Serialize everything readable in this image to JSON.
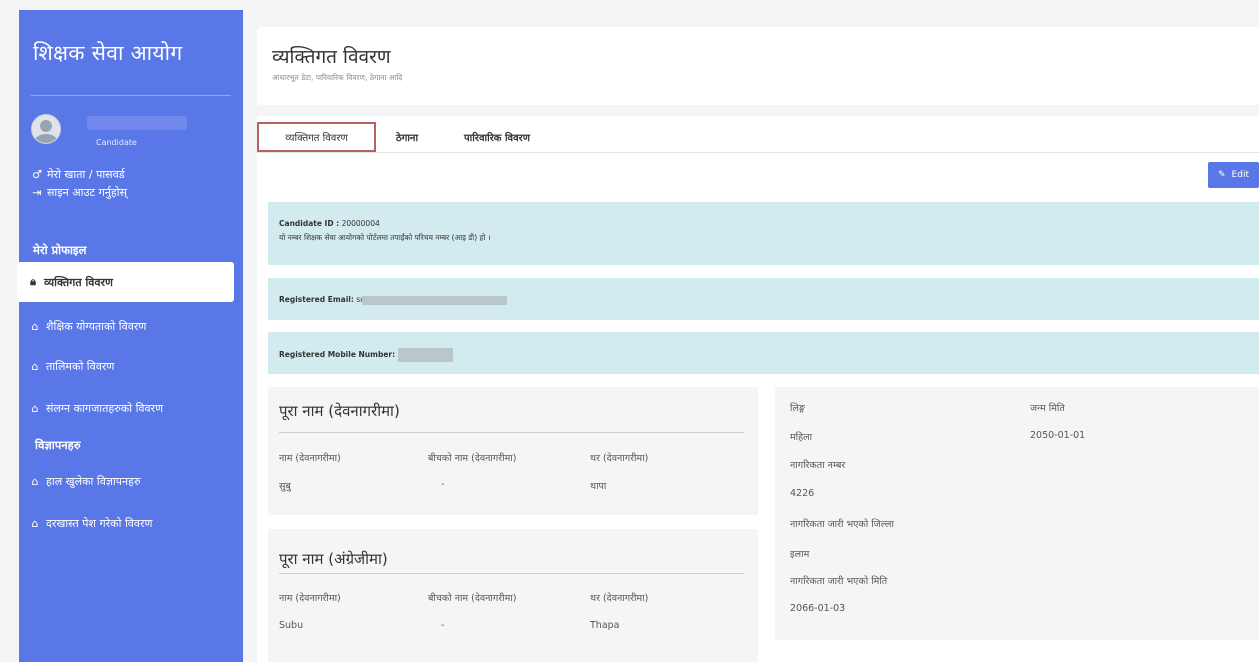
{
  "sidebar": {
    "brand": "शिक्षक सेवा आयोग",
    "user_role": "Candidate",
    "account_link": "मेरो खाता / पासवर्ड",
    "signout_link": "साइन आउट गर्नुहोस्",
    "profile_section": "मेरो प्रोफाइल",
    "items": [
      {
        "label": "व्यक्तिगत विवरण"
      },
      {
        "label": "शैक्षिक योग्यताको विवरण"
      },
      {
        "label": "तालिमको विवरण"
      },
      {
        "label": "संलग्न कागजातहरुको विवरण"
      }
    ],
    "ads_section": "विज्ञापनहरु",
    "ad_items": [
      {
        "label": "हाल खुलेका विज्ञापनहरु"
      },
      {
        "label": "दरखास्त पेश गरेको विवरण"
      }
    ]
  },
  "header": {
    "title": "व्यक्तिगत विवरण",
    "subtitle": "आधारभूत डेटा, पारिवारिक विवरण, ठेगाना आदि"
  },
  "tabs": [
    {
      "label": "व्यक्तिगत विवरण"
    },
    {
      "label": "ठेगाना"
    },
    {
      "label": "पारिवारिक विवरण"
    }
  ],
  "edit_label": "Edit",
  "candidate": {
    "id_label": "Candidate ID :",
    "id_value": "20000004",
    "id_note": "यो नम्बर शिक्षक सेवा आयोगको पोर्टलमा तपाईंको परिचय नम्बर (आइ डी) हो ।",
    "email_label": "Registered Email:",
    "email_visible": "sı",
    "mobile_label": "Registered Mobile Number:"
  },
  "name_np": {
    "title": "पूरा नाम (देवनागरीमा)",
    "labels": [
      "नाम (देवनागरीमा)",
      "बीचको नाम (देवनागरीमा)",
      "थर (देवनागरीमा)"
    ],
    "values": [
      "सुबु",
      "-",
      "थापा"
    ]
  },
  "name_en": {
    "title": "पूरा नाम (अंग्रेजीमा)",
    "labels": [
      "नाम (देवनागरीमा)",
      "बीचको नाम (देवनागरीमा)",
      "थर (देवनागरीमा)"
    ],
    "values": [
      "Subu",
      "-",
      "Thapa"
    ]
  },
  "details": {
    "gender_label": "लिङ्ग",
    "gender_value": "महिला",
    "dob_label": "जन्म मिति",
    "dob_value": "2050-01-01",
    "citizenship_no_label": "नागरिकता नम्बर",
    "citizenship_no_value": "4226",
    "district_label": "नागरिकता जारी भएको जिल्ला",
    "district_value": "इलाम",
    "issue_date_label": "नागरिकता जारी भएको मिति",
    "issue_date_value": "2066-01-03"
  }
}
